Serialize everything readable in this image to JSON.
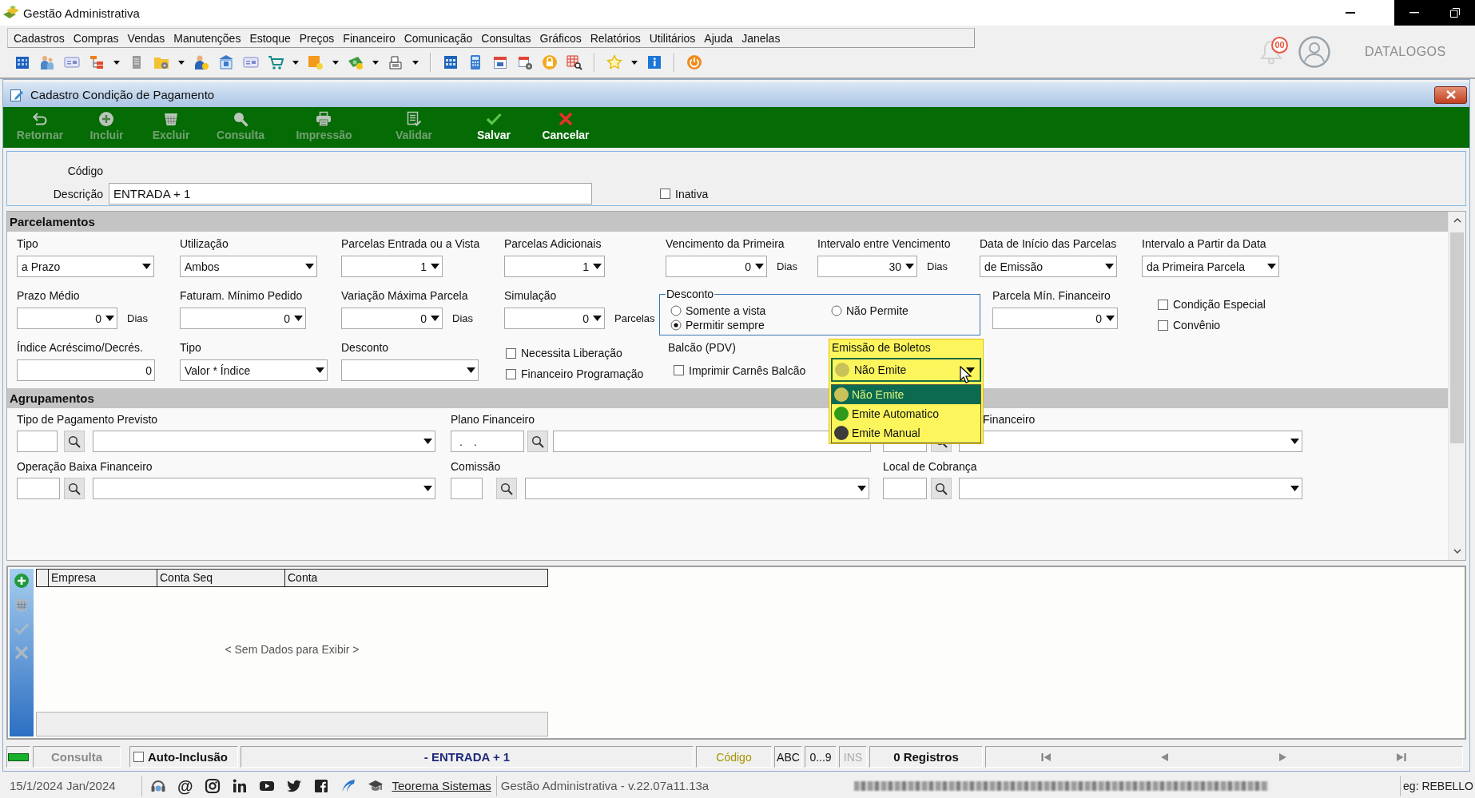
{
  "app": {
    "title": "Gestão Administrativa",
    "notifications": "00",
    "user": "DATALOGOS"
  },
  "menu": [
    "Cadastros",
    "Compras",
    "Vendas",
    "Manutenções",
    "Estoque",
    "Preços",
    "Financeiro",
    "Comunicação",
    "Consultas",
    "Gráficos",
    "Relatórios",
    "Utilitários",
    "Ajuda",
    "Janelas"
  ],
  "window": {
    "title": "Cadastro Condição de Pagamento"
  },
  "actions": [
    {
      "kind": "return",
      "label": "Retornar",
      "disabled": true
    },
    {
      "kind": "add",
      "label": "Incluir",
      "disabled": true
    },
    {
      "kind": "delete",
      "label": "Excluir",
      "disabled": true
    },
    {
      "kind": "search",
      "label": "Consulta",
      "disabled": true
    },
    {
      "kind": "print",
      "label": "Impressão",
      "disabled": true
    },
    {
      "kind": "validate",
      "label": "Validar",
      "disabled": true
    },
    {
      "kind": "save",
      "label": "Salvar",
      "disabled": false
    },
    {
      "kind": "cancel",
      "label": "Cancelar",
      "disabled": false
    }
  ],
  "header": {
    "code_label": "Código",
    "description_label": "Descrição",
    "description": "ENTRADA + 1",
    "inactive": {
      "label": "Inativa",
      "checked": false
    }
  },
  "parcelamentos": {
    "title": "Parcelamentos",
    "rows": [
      [
        {
          "kind": "combo",
          "label": "Tipo",
          "value": "a Prazo"
        },
        {
          "kind": "combo",
          "label": "Utilização",
          "value": "Ambos"
        },
        {
          "kind": "spin",
          "label": "Parcelas Entrada ou a Vista",
          "value": "1"
        },
        {
          "kind": "spin",
          "label": "Parcelas Adicionais",
          "value": "1"
        },
        {
          "kind": "spin",
          "label": "Vencimento da Primeira",
          "value": "0",
          "unit": "Dias"
        },
        {
          "kind": "spin",
          "label": "Intervalo entre Vencimento",
          "value": "30",
          "unit": "Dias"
        },
        {
          "kind": "combo",
          "label": "Data de Início das Parcelas",
          "value": "de Emissão"
        },
        {
          "kind": "combo",
          "label": "Intervalo a Partir da Data",
          "value": "da Primeira Parcela"
        }
      ],
      [
        {
          "kind": "spin",
          "label": "Prazo Médio",
          "value": "0",
          "unit": "Dias"
        },
        {
          "kind": "spin",
          "label": "Faturam. Mínimo Pedido",
          "value": "0"
        },
        {
          "kind": "spin",
          "label": "Variação Máxima Parcela",
          "value": "0",
          "unit": "Dias"
        },
        {
          "kind": "spin",
          "label": "Simulação",
          "value": "0",
          "unit": "Parcelas"
        },
        {
          "kind": "radios",
          "label": "Desconto",
          "options": [
            {
              "label": "Somente a vista",
              "selected": false
            },
            {
              "label": "Não Permite",
              "selected": false
            },
            {
              "label": "Permitir sempre",
              "selected": true
            }
          ]
        },
        "",
        {
          "kind": "spin",
          "label": "Parcela Mín. Financeiro",
          "value": "0"
        },
        {
          "kind": "checks",
          "items": [
            {
              "label": "Condição Especial",
              "checked": false
            },
            {
              "label": "Convênio",
              "checked": false
            }
          ]
        }
      ],
      [
        {
          "kind": "text",
          "label": "Índice Acréscimo/Decrés.",
          "value": "0"
        },
        {
          "kind": "combo",
          "label": "Tipo",
          "value": "Valor * Índice"
        },
        {
          "kind": "combo",
          "label": "Desconto"
        },
        {
          "kind": "checks",
          "items": [
            {
              "label": "Necessita Liberação",
              "checked": false
            },
            {
              "label": "Financeiro Programação",
              "checked": false
            }
          ]
        },
        {
          "kind": "checks",
          "label": "Balcão (PDV)",
          "items": [
            {
              "label": "Imprimir Carnês Balcão",
              "checked": false
            }
          ]
        },
        {
          "kind": "picker",
          "label": "Emissão de Boletos",
          "value": "Não Emite",
          "expanded": true,
          "options": [
            {
              "label": "Não Emite",
              "color": "#c9c25a",
              "selected": true
            },
            {
              "label": "Emite Automatico",
              "color": "#2f9a1c",
              "selected": false
            },
            {
              "label": "Emite Manual",
              "color": "#3c3c3a",
              "selected": false
            }
          ]
        }
      ]
    ]
  },
  "agrupamentos": {
    "title": "Agrupamentos",
    "rows": [
      [
        {
          "kind": "lookup",
          "label": "Tipo de Pagamento Previsto"
        },
        {
          "kind": "lookup",
          "label": "Plano Financeiro",
          "code": ". ."
        },
        {
          "kind": "lookup",
          "label": "Financeiro"
        }
      ],
      [
        {
          "kind": "lookup",
          "label": "Operação Baixa Financeiro"
        },
        {
          "kind": "lookup",
          "label": "Comissão"
        },
        {
          "kind": "lookup",
          "label": "Local de Cobrança"
        }
      ]
    ]
  },
  "grid": {
    "tools": [
      {
        "kind": "add",
        "disabled": false
      },
      {
        "kind": "delete",
        "disabled": true
      },
      {
        "kind": "confirm",
        "disabled": true
      },
      {
        "kind": "cancel",
        "disabled": true
      }
    ],
    "columns": [
      "Empresa",
      "Conta Seq",
      "Conta"
    ],
    "empty_message": "< Sem Dados para Exibir >"
  },
  "status_bar": {
    "mode": "Consulta",
    "auto_inclusion": {
      "label": "Auto-Inclusão",
      "checked": false
    },
    "record": "- ENTRADA + 1",
    "search_field": "Código",
    "toggles": [
      {
        "label": "ABC",
        "disabled": false
      },
      {
        "label": "0...9",
        "disabled": false
      },
      {
        "label": "INS",
        "disabled": true
      }
    ],
    "count": "0 Registros"
  },
  "footer": {
    "date": "15/1/2024 Jan/2024",
    "links": [
      {
        "kind": "headset"
      },
      {
        "kind": "at",
        "text": "@"
      },
      {
        "kind": "camera"
      },
      {
        "kind": "in"
      },
      {
        "kind": "play"
      },
      {
        "kind": "bird"
      },
      {
        "kind": "f"
      },
      {
        "kind": "swoosh"
      },
      {
        "kind": "cap"
      }
    ],
    "company": "Teorema Sistemas",
    "version": "Gestão Administrativa - v.22.07a11.13a",
    "user": "eg: REBELLO"
  }
}
